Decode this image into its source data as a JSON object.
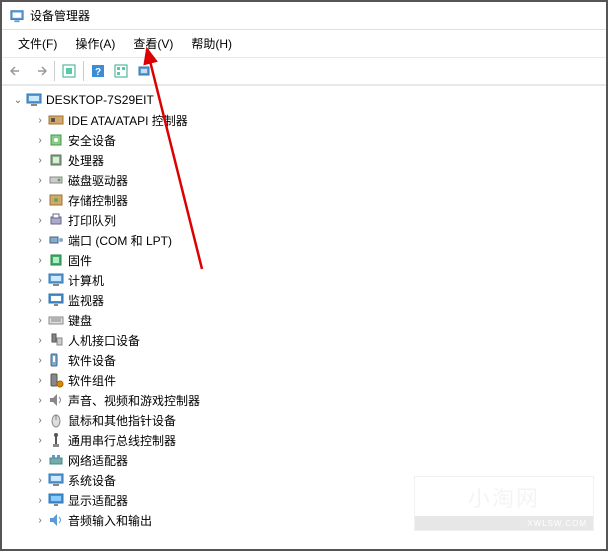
{
  "title": "设备管理器",
  "menu": [
    "文件(F)",
    "操作(A)",
    "查看(V)",
    "帮助(H)"
  ],
  "root": {
    "label": "DESKTOP-7S29EIT"
  },
  "categories": [
    {
      "label": "IDE ATA/ATAPI 控制器",
      "icon": "ide"
    },
    {
      "label": "安全设备",
      "icon": "security"
    },
    {
      "label": "处理器",
      "icon": "cpu"
    },
    {
      "label": "磁盘驱动器",
      "icon": "disk"
    },
    {
      "label": "存储控制器",
      "icon": "storage"
    },
    {
      "label": "打印队列",
      "icon": "printer"
    },
    {
      "label": "端口 (COM 和 LPT)",
      "icon": "port"
    },
    {
      "label": "固件",
      "icon": "firmware"
    },
    {
      "label": "计算机",
      "icon": "computer"
    },
    {
      "label": "监视器",
      "icon": "monitor"
    },
    {
      "label": "键盘",
      "icon": "keyboard"
    },
    {
      "label": "人机接口设备",
      "icon": "hid"
    },
    {
      "label": "软件设备",
      "icon": "software"
    },
    {
      "label": "软件组件",
      "icon": "component"
    },
    {
      "label": "声音、视频和游戏控制器",
      "icon": "audio"
    },
    {
      "label": "鼠标和其他指针设备",
      "icon": "mouse"
    },
    {
      "label": "通用串行总线控制器",
      "icon": "usb"
    },
    {
      "label": "网络适配器",
      "icon": "network"
    },
    {
      "label": "系统设备",
      "icon": "system"
    },
    {
      "label": "显示适配器",
      "icon": "display"
    },
    {
      "label": "音频输入和输出",
      "icon": "audioio"
    }
  ],
  "watermark": {
    "main": "小淘网",
    "sub": "XWLSW.COM"
  }
}
